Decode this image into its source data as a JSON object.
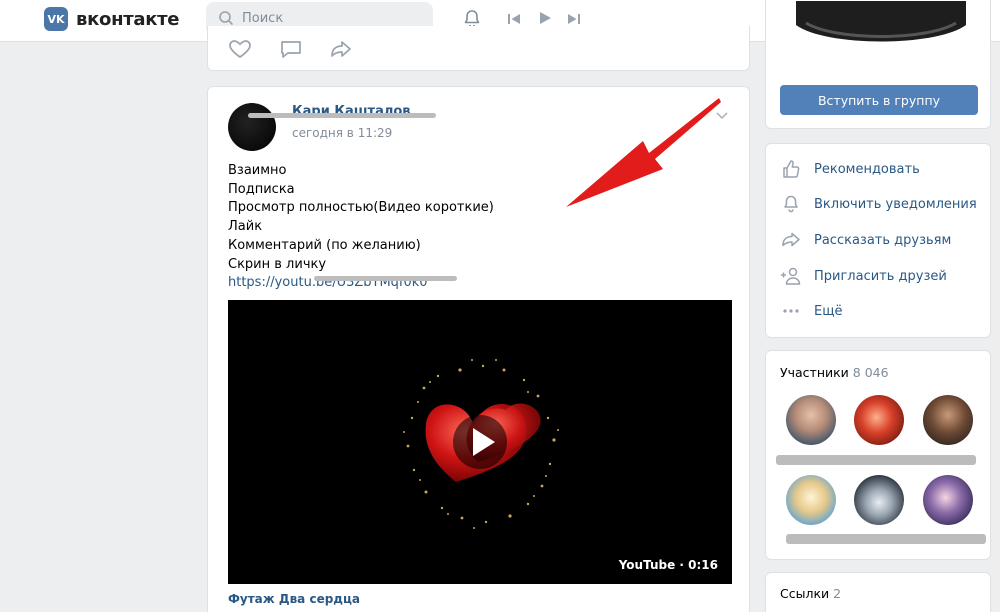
{
  "header": {
    "logo_mark": "VK",
    "logo_text": "вконтакте",
    "search_placeholder": "Поиск"
  },
  "post": {
    "author": "Кари Кашталов",
    "time": "сегодня в 11:29",
    "lines": [
      "Взаимно",
      "Подписка",
      "Просмотр полностью(Видео короткие)",
      "Лайк",
      "Комментарий (по желанию)",
      "Скрин в личку"
    ],
    "link": "https://youtu.be/U3ZbYMqf0k0",
    "video_source": "YouTube · 0:16",
    "video_title": "Футаж Два сердца"
  },
  "sidebar": {
    "join_button": "Вступить в группу",
    "menu": [
      {
        "label": "Рекомендовать",
        "icon": "thumbs-up-icon"
      },
      {
        "label": "Включить уведомления",
        "icon": "bell-icon"
      },
      {
        "label": "Рассказать друзьям",
        "icon": "share-icon"
      },
      {
        "label": "Пригласить друзей",
        "icon": "add-user-icon"
      },
      {
        "label": "Ещё",
        "icon": "more-icon"
      }
    ],
    "members_title": "Участники",
    "members_count": "8 046",
    "links_title": "Ссылки",
    "links_count": "2"
  },
  "colors": {
    "accent": "#5181b8",
    "link": "#2a5885",
    "arrow": "#e21b1b"
  }
}
